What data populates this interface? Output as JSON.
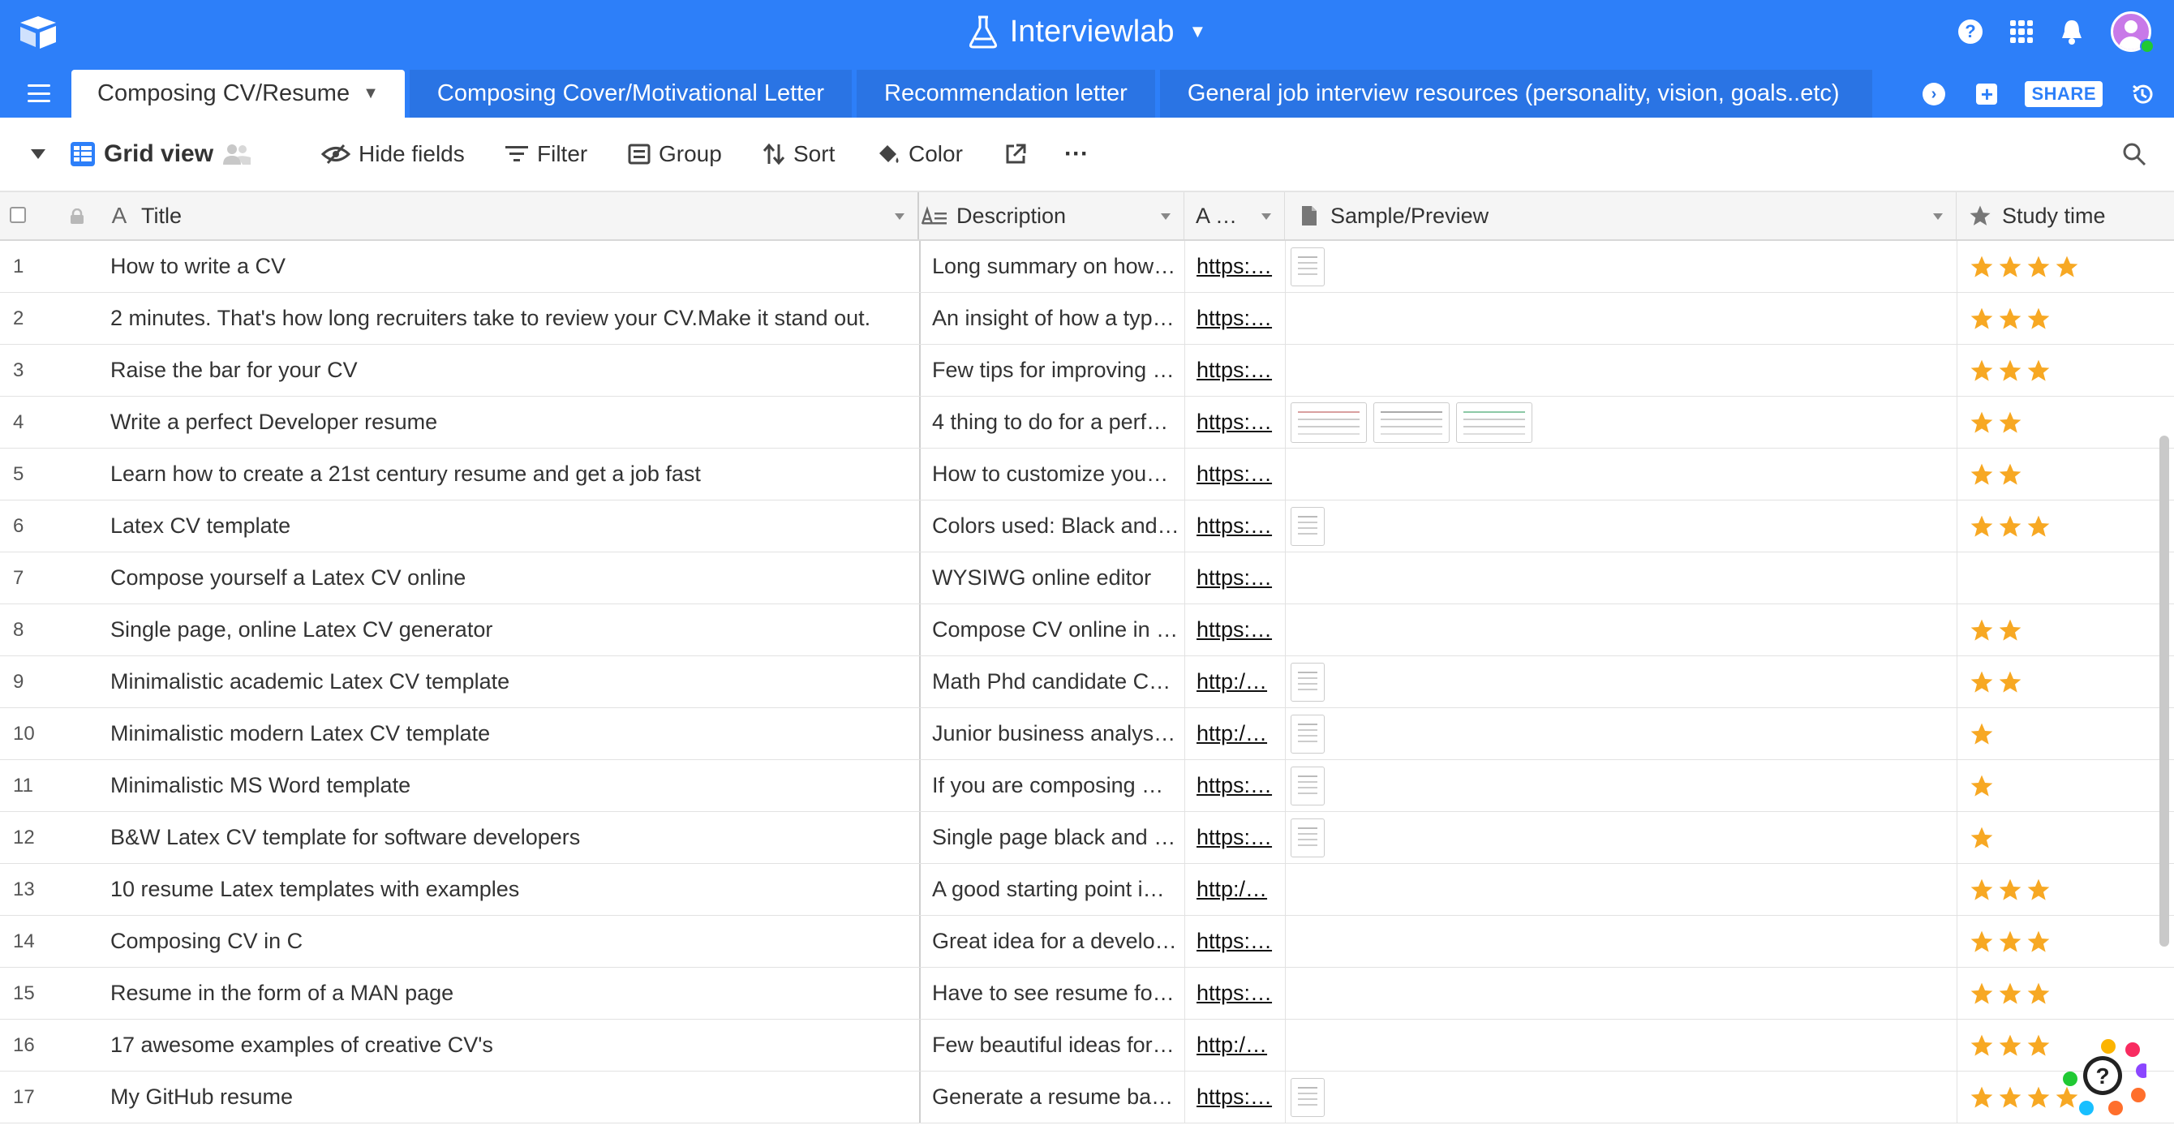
{
  "header": {
    "app_title": "Interviewlab"
  },
  "tabs": [
    {
      "label": "Composing CV/Resume",
      "active": true
    },
    {
      "label": "Composing Cover/Motivational Letter",
      "active": false
    },
    {
      "label": "Recommendation letter",
      "active": false
    },
    {
      "label": "General job interview resources (personality, vision, goals..etc)",
      "active": false
    }
  ],
  "share_label": "SHARE",
  "toolbar": {
    "view_name": "Grid view",
    "hide_fields": "Hide fields",
    "filter": "Filter",
    "group": "Group",
    "sort": "Sort",
    "color": "Color",
    "more": "···"
  },
  "columns": {
    "title": "Title",
    "description": "Description",
    "link": "A …",
    "sample": "Sample/Preview",
    "study_time": "Study time"
  },
  "rows": [
    {
      "n": "1",
      "title": "How to write a CV",
      "desc": "Long summary on how…",
      "link": "https:…",
      "thumbs": [
        "doc"
      ],
      "stars": 4
    },
    {
      "n": "2",
      "title": "2 minutes. That's how long recruiters take to review your CV.Make it stand out.",
      "desc": "An insight of how a typ…",
      "link": "https:…",
      "thumbs": [],
      "stars": 3
    },
    {
      "n": "3",
      "title": "Raise the bar for your CV",
      "desc": "Few tips for improving …",
      "link": "https:…",
      "thumbs": [],
      "stars": 3
    },
    {
      "n": "4",
      "title": "Write a perfect Developer resume",
      "desc": "4 thing to do for a perf…",
      "link": "https:…",
      "thumbs": [
        "wide",
        "wide-gray",
        "wide-green"
      ],
      "stars": 2
    },
    {
      "n": "5",
      "title": "Learn how to create a 21st century resume and get a job fast",
      "desc": "How to customize you…",
      "link": "https:…",
      "thumbs": [],
      "stars": 2
    },
    {
      "n": "6",
      "title": "Latex CV template",
      "desc": "Colors used: Black and…",
      "link": "https:…",
      "thumbs": [
        "doc"
      ],
      "stars": 3
    },
    {
      "n": "7",
      "title": "Compose yourself a Latex CV online",
      "desc": "WYSIWG online editor",
      "link": "https:…",
      "thumbs": [],
      "stars": 0
    },
    {
      "n": "8",
      "title": "Single page, online Latex CV generator",
      "desc": "Compose CV online in …",
      "link": "https:…",
      "thumbs": [],
      "stars": 2
    },
    {
      "n": "9",
      "title": "Minimalistic academic Latex CV template",
      "desc": "Math Phd candidate C…",
      "link": "http:/…",
      "thumbs": [
        "doc"
      ],
      "stars": 2
    },
    {
      "n": "10",
      "title": "Minimalistic modern Latex CV template",
      "desc": "Junior business analys…",
      "link": "http:/…",
      "thumbs": [
        "doc"
      ],
      "stars": 1
    },
    {
      "n": "11",
      "title": "Minimalistic MS Word template",
      "desc": "If you are composing …",
      "link": "https:…",
      "thumbs": [
        "doc"
      ],
      "stars": 1
    },
    {
      "n": "12",
      "title": "B&W Latex CV template for software developers",
      "desc": "Single page black and …",
      "link": "https:…",
      "thumbs": [
        "doc"
      ],
      "stars": 1
    },
    {
      "n": "13",
      "title": "10 resume Latex templates with examples",
      "desc": "A good starting point i…",
      "link": "http:/…",
      "thumbs": [],
      "stars": 3
    },
    {
      "n": "14",
      "title": "Composing CV in C",
      "desc": "Great idea for a develo…",
      "link": "https:…",
      "thumbs": [],
      "stars": 3
    },
    {
      "n": "15",
      "title": "Resume in the form of a MAN page",
      "desc": "Have to see resume fo…",
      "link": "https:…",
      "thumbs": [],
      "stars": 3
    },
    {
      "n": "16",
      "title": "17 awesome examples of creative CV's",
      "desc": "Few beautiful ideas for…",
      "link": "http:/…",
      "thumbs": [],
      "stars": 3
    },
    {
      "n": "17",
      "title": "My GitHub resume",
      "desc": "Generate a resume ba…",
      "link": "https:…",
      "thumbs": [
        "doc"
      ],
      "stars": 4
    }
  ],
  "colors": {
    "brand_blue": "#2d7ff9",
    "tab_blue": "#2a74e4",
    "star": "#f7a823"
  }
}
